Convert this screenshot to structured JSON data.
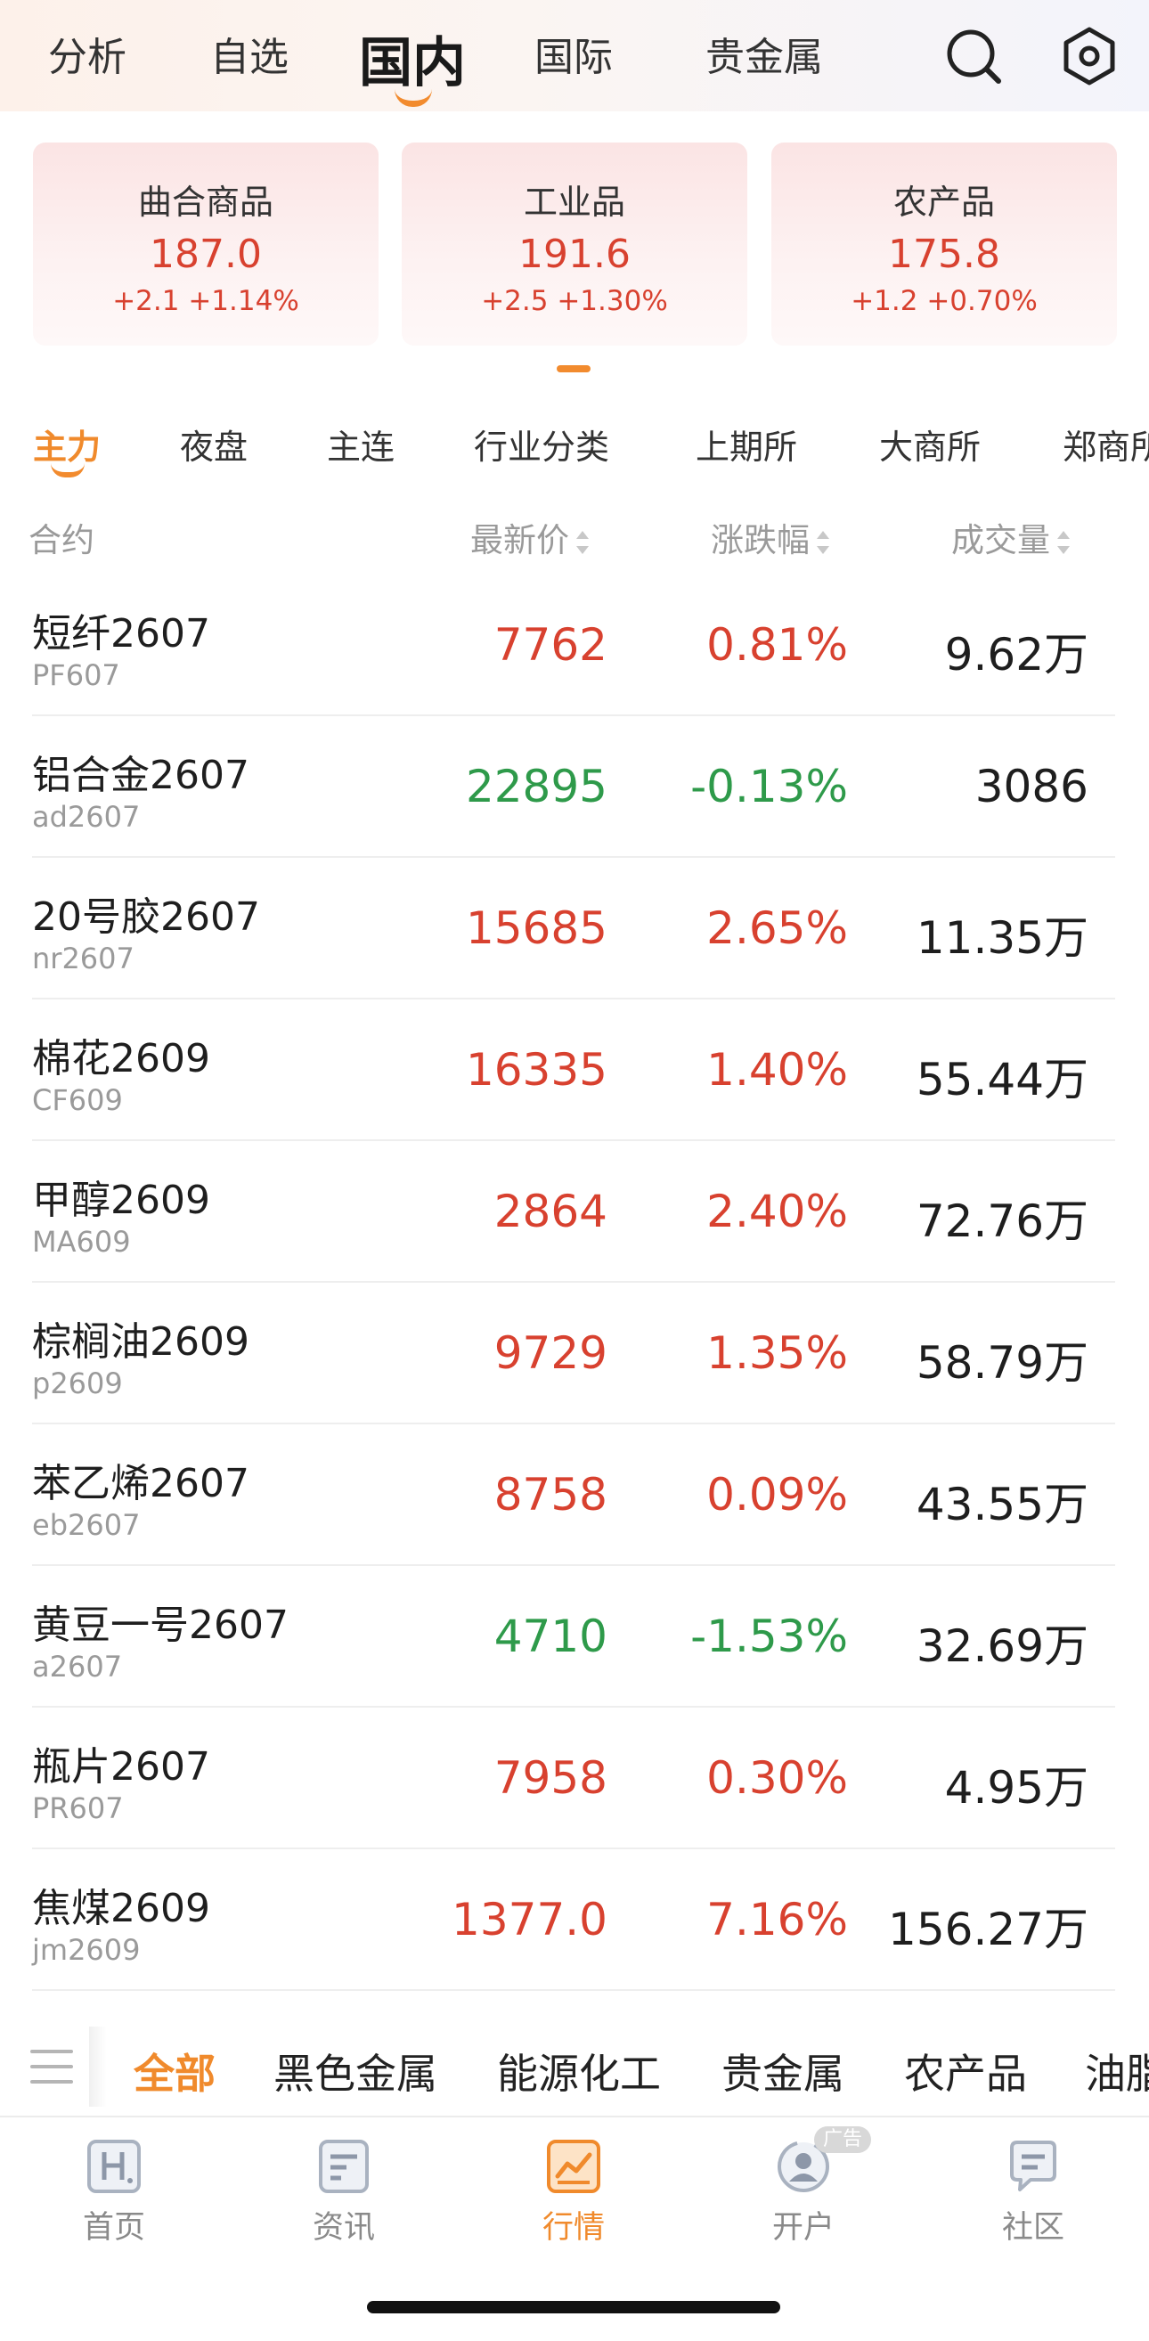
{
  "topnav": {
    "tabs": [
      {
        "label": "分析"
      },
      {
        "label": "自选"
      },
      {
        "label": "国内"
      },
      {
        "label": "国际"
      },
      {
        "label": "贵金属"
      }
    ],
    "active": "国内",
    "icons": [
      "search-icon",
      "settings-hex-icon"
    ]
  },
  "index_cards": [
    {
      "name": "曲合商品",
      "value": "187.0",
      "change": "+2.1 +1.14%"
    },
    {
      "name": "工业品",
      "value": "191.6",
      "change": "+2.5 +1.30%"
    },
    {
      "name": "农产品",
      "value": "175.8",
      "change": "+1.2 +0.70%"
    }
  ],
  "category_tabs": [
    {
      "label": "主力"
    },
    {
      "label": "夜盘"
    },
    {
      "label": "主连"
    },
    {
      "label": "行业分类"
    },
    {
      "label": "上期所"
    },
    {
      "label": "大商所"
    },
    {
      "label": "郑商所"
    }
  ],
  "columns": {
    "contract": "合约",
    "price": "最新价",
    "change_pct": "涨跌幅",
    "volume": "成交量"
  },
  "rows": [
    {
      "name": "短纤2607",
      "code": "PF607",
      "price": "7762",
      "pct": "0.81%",
      "volume": "9.62万",
      "dir": "up"
    },
    {
      "name": "铝合金2607",
      "code": "ad2607",
      "price": "22895",
      "pct": "-0.13%",
      "volume": "3086",
      "dir": "down"
    },
    {
      "name": "20号胶2607",
      "code": "nr2607",
      "price": "15685",
      "pct": "2.65%",
      "volume": "11.35万",
      "dir": "up"
    },
    {
      "name": "棉花2609",
      "code": "CF609",
      "price": "16335",
      "pct": "1.40%",
      "volume": "55.44万",
      "dir": "up"
    },
    {
      "name": "甲醇2609",
      "code": "MA609",
      "price": "2864",
      "pct": "2.40%",
      "volume": "72.76万",
      "dir": "up"
    },
    {
      "name": "棕榈油2609",
      "code": "p2609",
      "price": "9729",
      "pct": "1.35%",
      "volume": "58.79万",
      "dir": "up"
    },
    {
      "name": "苯乙烯2607",
      "code": "eb2607",
      "price": "8758",
      "pct": "0.09%",
      "volume": "43.55万",
      "dir": "up"
    },
    {
      "name": "黄豆一号2607",
      "code": "a2607",
      "price": "4710",
      "pct": "-1.53%",
      "volume": "32.69万",
      "dir": "down"
    },
    {
      "name": "瓶片2607",
      "code": "PR607",
      "price": "7958",
      "pct": "0.30%",
      "volume": "4.95万",
      "dir": "up"
    },
    {
      "name": "焦煤2609",
      "code": "jm2609",
      "price": "1377.0",
      "pct": "7.16%",
      "volume": "156.27万",
      "dir": "up"
    }
  ],
  "sectors": [
    {
      "label": "全部"
    },
    {
      "label": "黑色金属"
    },
    {
      "label": "能源化工"
    },
    {
      "label": "贵金属"
    },
    {
      "label": "农产品"
    },
    {
      "label": "油脂"
    }
  ],
  "bottom_nav": [
    {
      "label": "首页",
      "icon": "home-h-icon"
    },
    {
      "label": "资讯",
      "icon": "news-icon"
    },
    {
      "label": "行情",
      "icon": "market-chart-icon"
    },
    {
      "label": "开户",
      "icon": "open-account-icon",
      "badge": "广告"
    },
    {
      "label": "社区",
      "icon": "community-chat-icon"
    }
  ],
  "colors": {
    "up": "#d8412f",
    "down": "#2e9a4a",
    "accent": "#f08a2c"
  }
}
